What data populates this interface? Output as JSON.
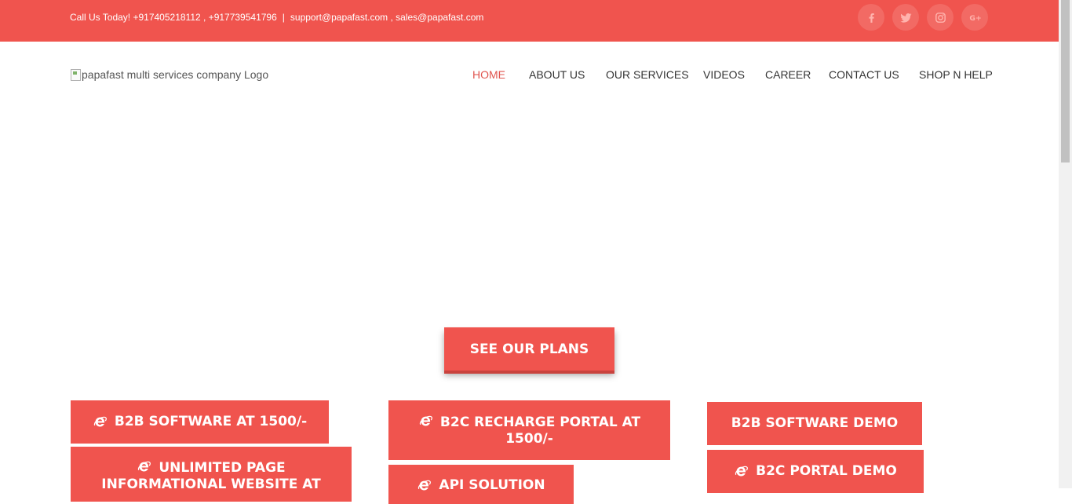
{
  "topbar": {
    "call_text": "Call Us Today! +917405218112 , +917739541796",
    "separator": "|",
    "emails": "support@papafast.com , sales@papafast.com",
    "social": [
      "facebook-icon",
      "twitter-icon",
      "instagram-icon",
      "google-plus-icon"
    ]
  },
  "logo": {
    "alt": "papafast multi services company Logo"
  },
  "nav": {
    "items": [
      "HOME",
      "ABOUT US",
      "OUR SERVICES",
      "VIDEOS",
      "CAREER",
      "CONTACT US",
      "SHOP N HELP"
    ],
    "active": "HOME"
  },
  "cta": {
    "see_plans": "SEE OUR PLANS"
  },
  "buttons": {
    "b2b_software": "B2B SOFTWARE AT 1500/-",
    "unlimited_page": "UNLIMITED PAGE INFORMATIONAL WEBSITE AT",
    "b2c_recharge": "B2C RECHARGE PORTAL AT 1500/-",
    "api_solution": "API SOLUTION",
    "b2b_demo": "B2B SOFTWARE DEMO",
    "b2c_demo": "B2C PORTAL DEMO"
  },
  "colors": {
    "accent": "#f0544e",
    "nav_text": "#333333",
    "nav_active": "#e0544e"
  }
}
